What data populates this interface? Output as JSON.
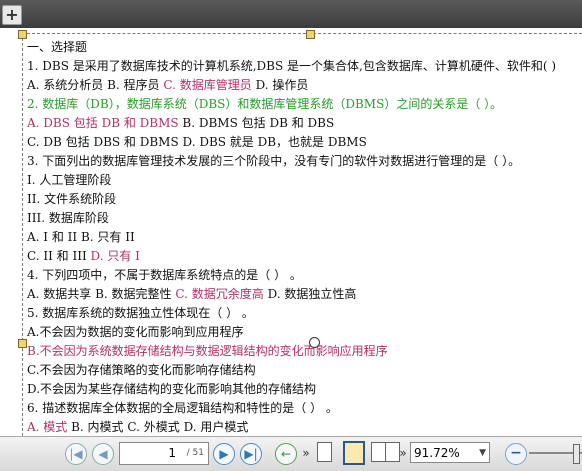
{
  "toolbar_top": {
    "add_icon": "plus-icon"
  },
  "document": {
    "lines": [
      [
        {
          "t": "一、选择题",
          "c": ""
        }
      ],
      [
        {
          "t": "1. DBS 是采用了数据库技术的计算机系统,DBS 是一个集合体,包含数据库、计算机硬件、软件和(    )",
          "c": ""
        }
      ],
      [
        {
          "t": "A.  系统分析员  B.  程序员  ",
          "c": ""
        },
        {
          "t": "C.  数据库管理员",
          "c": "pink"
        },
        {
          "t": "  D.  操作员",
          "c": ""
        }
      ],
      [
        {
          "t": "2.  数据库（DB），数据库系统（DBS）和数据库管理系统（DBMS）之间的关系是（  ）。",
          "c": "green"
        }
      ],
      [
        {
          "t": "A. DBS 包括 DB 和 DBMS",
          "c": "pink"
        },
        {
          "t": " B. DBMS 包括 DB 和 DBS",
          "c": ""
        }
      ],
      [
        {
          "t": "C. DB 包括 DBS 和 DBMS D. DBS 就是 DB，也就是 DBMS",
          "c": ""
        }
      ],
      [
        {
          "t": "3.  下面列出的数据库管理技术发展的三个阶段中，没有专门的软件对数据进行管理的是（  ）。",
          "c": ""
        }
      ],
      [
        {
          "t": "I.   人工管理阶段",
          "c": ""
        }
      ],
      [
        {
          "t": "II.   文件系统阶段",
          "c": ""
        }
      ],
      [
        {
          "t": "III.   数据库阶段",
          "c": ""
        }
      ],
      [
        {
          "t": "A. I   和   II B.   只有   II",
          "c": ""
        }
      ],
      [
        {
          "t": "C. II   和   III ",
          "c": ""
        },
        {
          "t": "D.   只有   I",
          "c": "pink"
        }
      ],
      [
        {
          "t": "4.   下列四项中，不属于数据库系统特点的是（  ）  。",
          "c": ""
        }
      ],
      [
        {
          "t": "A.  数据共享  B.  数据完整性  ",
          "c": ""
        },
        {
          "t": "C.  数据冗余度高",
          "c": "pink"
        },
        {
          "t": "  D.  数据独立性高",
          "c": ""
        }
      ],
      [
        {
          "t": "5.  数据库系统的数据独立性体现在（   ）  。",
          "c": ""
        }
      ],
      [
        {
          "t": "A.不会因为数据的变化而影响到应用程序",
          "c": ""
        }
      ],
      [
        {
          "t": "B.不会因为系统数据存储结构与数据逻辑结构的变化而影响应用程序",
          "c": "pink"
        }
      ],
      [
        {
          "t": "C.不会因为存储策略的变化而影响存储结构",
          "c": ""
        }
      ],
      [
        {
          "t": "D.不会因为某些存储结构的变化而影响其他的存储结构",
          "c": ""
        }
      ],
      [
        {
          "t": "6.  描述数据库全体数据的全局逻辑结构和特性的是（   ）  。",
          "c": ""
        }
      ],
      [
        {
          "t": "A.  模式",
          "c": "pink"
        },
        {
          "t": "  B.  内模式  C.  外模式  D.  用户模式",
          "c": ""
        }
      ]
    ]
  },
  "navbar": {
    "first_page_icon": "first-page-icon",
    "prev_page_icon": "prev-page-icon",
    "current_page": "1",
    "total_pages": "/ 51",
    "next_page_icon": "next-page-icon",
    "last_page_icon": "last-page-icon",
    "back_icon": "back-icon",
    "more_icon": "more-icon",
    "zoom_value": "91.72%",
    "zoom_out_icon": "zoom-out-icon"
  }
}
